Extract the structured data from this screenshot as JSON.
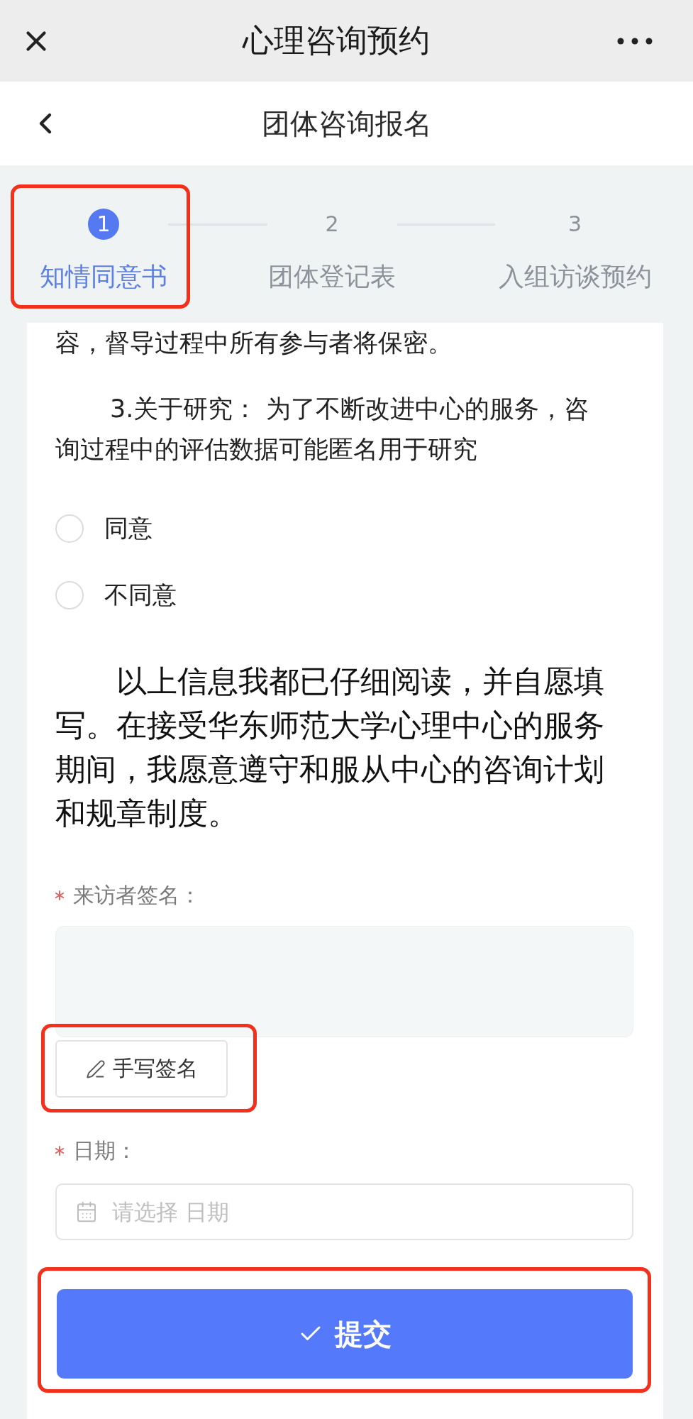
{
  "top_bar": {
    "title": "心理咨询预约"
  },
  "header": {
    "title": "团体咨询报名"
  },
  "steps": [
    {
      "number": "1",
      "label": "知情同意书",
      "selected": true,
      "highlighted": true
    },
    {
      "number": "2",
      "label": "团体登记表",
      "selected": false,
      "highlighted": false
    },
    {
      "number": "3",
      "label": "入组访谈预约",
      "selected": false,
      "highlighted": false
    }
  ],
  "consent": {
    "clipped_line": "容，督导过程中所有参与者将保密。",
    "research": {
      "text": "3.关于研究： 为了不断改进中心的服务，咨询过程中的评估数据可能匿名用于研究",
      "options": [
        {
          "label": "同意",
          "selected": false
        },
        {
          "label": "不同意",
          "selected": false
        }
      ]
    },
    "declaration": "以上信息我都已仔细阅读，并自愿填写。在接受华东师范大学心理中心的服务期间，我愿意遵守和服从中心的咨询计划和规章制度。"
  },
  "signature": {
    "label": "来访者签名：",
    "required": true,
    "button": {
      "label": "手写签名",
      "highlighted": true
    }
  },
  "date": {
    "label": "日期：",
    "required": true,
    "placeholder": "请选择 日期"
  },
  "submit": {
    "label": "提交",
    "highlighted": true
  }
}
